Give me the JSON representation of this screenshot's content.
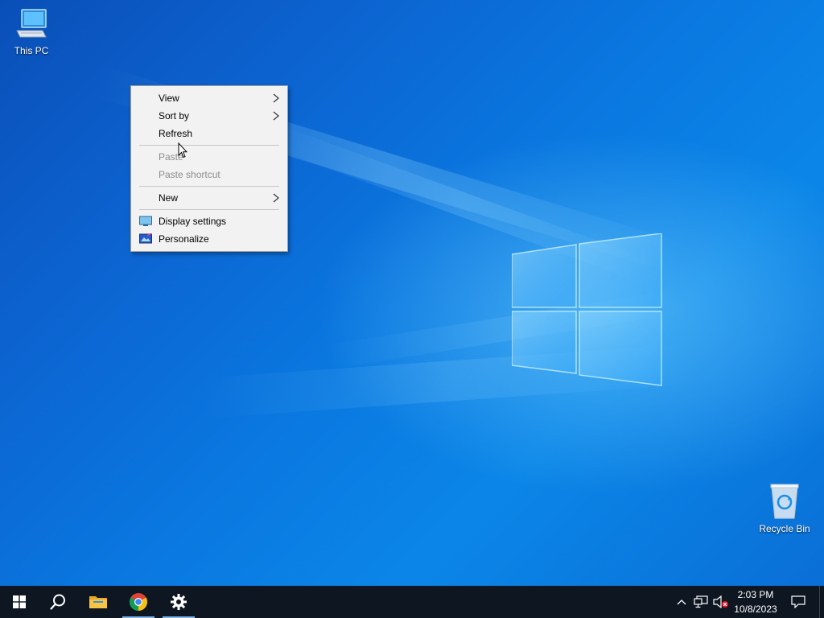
{
  "desktop": {
    "icons": [
      {
        "label": "This PC",
        "icon": "computer-icon"
      },
      {
        "label": "Recycle Bin",
        "icon": "recycle-bin-icon"
      }
    ]
  },
  "context_menu": {
    "items": [
      {
        "label": "View",
        "enabled": true,
        "submenu": true
      },
      {
        "label": "Sort by",
        "enabled": true,
        "submenu": true
      },
      {
        "label": "Refresh",
        "enabled": true,
        "submenu": false
      },
      {
        "label": "Paste",
        "enabled": false,
        "submenu": false
      },
      {
        "label": "Paste shortcut",
        "enabled": false,
        "submenu": false
      },
      {
        "label": "New",
        "enabled": true,
        "submenu": true
      },
      {
        "label": "Display settings",
        "enabled": true,
        "submenu": false,
        "icon": "display-icon"
      },
      {
        "label": "Personalize",
        "enabled": true,
        "submenu": false,
        "icon": "personalize-icon"
      }
    ]
  },
  "taskbar": {
    "buttons": [
      {
        "name": "start",
        "icon": "windows-start-icon"
      },
      {
        "name": "search",
        "icon": "search-icon"
      },
      {
        "name": "file-explorer",
        "icon": "folder-icon"
      },
      {
        "name": "chrome",
        "icon": "chrome-icon"
      },
      {
        "name": "settings",
        "icon": "gear-icon"
      }
    ],
    "clock": {
      "time": "2:03 PM",
      "date": "10/8/2023"
    }
  },
  "colors": {
    "desktop_blue": "#0a78e0",
    "taskbar": "#0e1621",
    "menu_bg": "#f2f2f2",
    "disabled_text": "#8d8d8d"
  }
}
